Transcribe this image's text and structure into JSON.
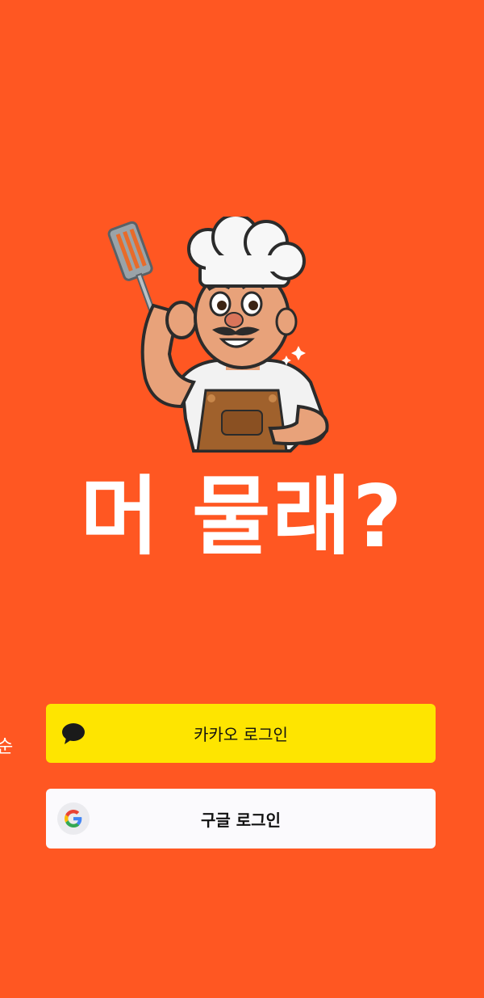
{
  "app": {
    "title": "머 물래?",
    "background_color": "#FF5722",
    "mascot": "chef-mascot-illustration"
  },
  "login": {
    "kakao": {
      "label": "카카오 로그인",
      "icon": "speech-bubble-icon",
      "color": "#FEE500"
    },
    "google": {
      "label": "구글 로그인",
      "icon": "google-g-icon",
      "color": "#FBFAFD"
    }
  },
  "edge_glyph": "순"
}
